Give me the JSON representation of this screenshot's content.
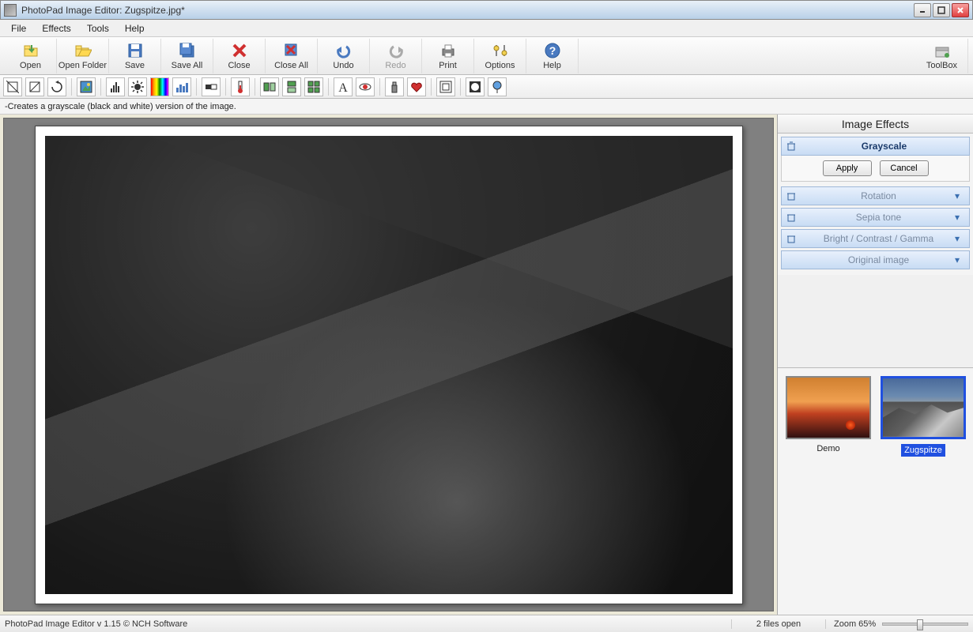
{
  "window": {
    "title": "PhotoPad Image Editor: Zugspitze.jpg*"
  },
  "menu": {
    "file": "File",
    "effects": "Effects",
    "tools": "Tools",
    "help": "Help"
  },
  "toolbar": {
    "open": "Open",
    "open_folder": "Open Folder",
    "save": "Save",
    "save_all": "Save All",
    "close": "Close",
    "close_all": "Close All",
    "undo": "Undo",
    "redo": "Redo",
    "print": "Print",
    "options": "Options",
    "help": "Help",
    "toolbox": "ToolBox"
  },
  "hint": "-Creates a grayscale (black and white) version of the image.",
  "panel": {
    "title": "Image Effects",
    "effects": {
      "grayscale": "Grayscale",
      "rotation": "Rotation",
      "sepia": "Sepia tone",
      "bcg": "Bright / Contrast / Gamma",
      "original": "Original image"
    },
    "apply": "Apply",
    "cancel": "Cancel"
  },
  "thumbs": {
    "demo": "Demo",
    "zugspitze": "Zugspitze"
  },
  "status": {
    "left": "PhotoPad Image Editor v 1.15 © NCH Software",
    "files": "2 files open",
    "zoom_label": "Zoom 65%"
  }
}
